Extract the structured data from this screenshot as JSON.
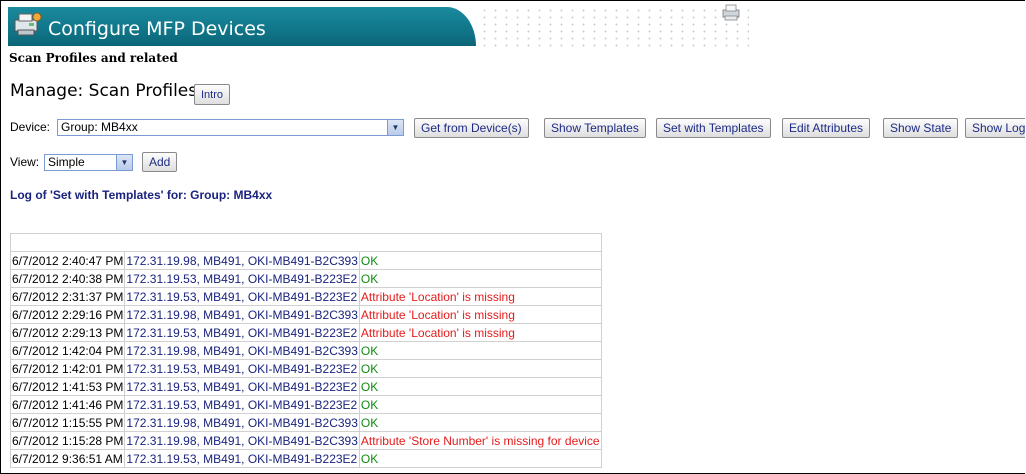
{
  "header": {
    "title": "Configure MFP Devices",
    "subtitle": "Scan Profiles and related"
  },
  "manage": {
    "label": "Manage: Scan Profiles",
    "intro_button": "Intro"
  },
  "device": {
    "label": "Device:",
    "selected": "Group: MB4xx",
    "buttons": [
      "Get from Device(s)",
      "Show Templates",
      "Set with Templates",
      "Edit Attributes",
      "Show State",
      "Show Log"
    ]
  },
  "view": {
    "label": "View:",
    "selected": "Simple",
    "add_button": "Add"
  },
  "log": {
    "heading": "Log of 'Set with Templates' for: Group: MB4xx",
    "rows": [
      {
        "time": "6/7/2012 2:40:47 PM",
        "device": "172.31.19.98, MB491, OKI-MB491-B2C393",
        "status": "OK",
        "ok": true
      },
      {
        "time": "6/7/2012 2:40:38 PM",
        "device": "172.31.19.53, MB491, OKI-MB491-B223E2",
        "status": "OK",
        "ok": true
      },
      {
        "time": "6/7/2012 2:31:37 PM",
        "device": "172.31.19.53, MB491, OKI-MB491-B223E2",
        "status": "Attribute 'Location' is missing",
        "ok": false
      },
      {
        "time": "6/7/2012 2:29:16 PM",
        "device": "172.31.19.98, MB491, OKI-MB491-B2C393",
        "status": "Attribute 'Location' is missing",
        "ok": false
      },
      {
        "time": "6/7/2012 2:29:13 PM",
        "device": "172.31.19.53, MB491, OKI-MB491-B223E2",
        "status": "Attribute 'Location' is missing",
        "ok": false
      },
      {
        "time": "6/7/2012 1:42:04 PM",
        "device": "172.31.19.98, MB491, OKI-MB491-B2C393",
        "status": "OK",
        "ok": true
      },
      {
        "time": "6/7/2012 1:42:01 PM",
        "device": "172.31.19.53, MB491, OKI-MB491-B223E2",
        "status": "OK",
        "ok": true
      },
      {
        "time": "6/7/2012 1:41:53 PM",
        "device": "172.31.19.53, MB491, OKI-MB491-B223E2",
        "status": "OK",
        "ok": true
      },
      {
        "time": "6/7/2012 1:41:46 PM",
        "device": "172.31.19.53, MB491, OKI-MB491-B223E2",
        "status": "OK",
        "ok": true
      },
      {
        "time": "6/7/2012 1:15:55 PM",
        "device": "172.31.19.98, MB491, OKI-MB491-B2C393",
        "status": "OK",
        "ok": true
      },
      {
        "time": "6/7/2012 1:15:28 PM",
        "device": "172.31.19.98, MB491, OKI-MB491-B2C393",
        "status": "Attribute 'Store Number' is missing for device",
        "ok": false
      },
      {
        "time": "6/7/2012 9:36:51 AM",
        "device": "172.31.19.53, MB491, OKI-MB491-B223E2",
        "status": "OK",
        "ok": true
      }
    ]
  },
  "icons": {
    "banner": "mfp-device-icon",
    "printer": "printer-icon",
    "dropdown": "chevron-down-icon"
  },
  "colors": {
    "banner": "#11778b",
    "link_text": "#1a237e",
    "ok": "#108a10",
    "error": "#e41b1b"
  }
}
